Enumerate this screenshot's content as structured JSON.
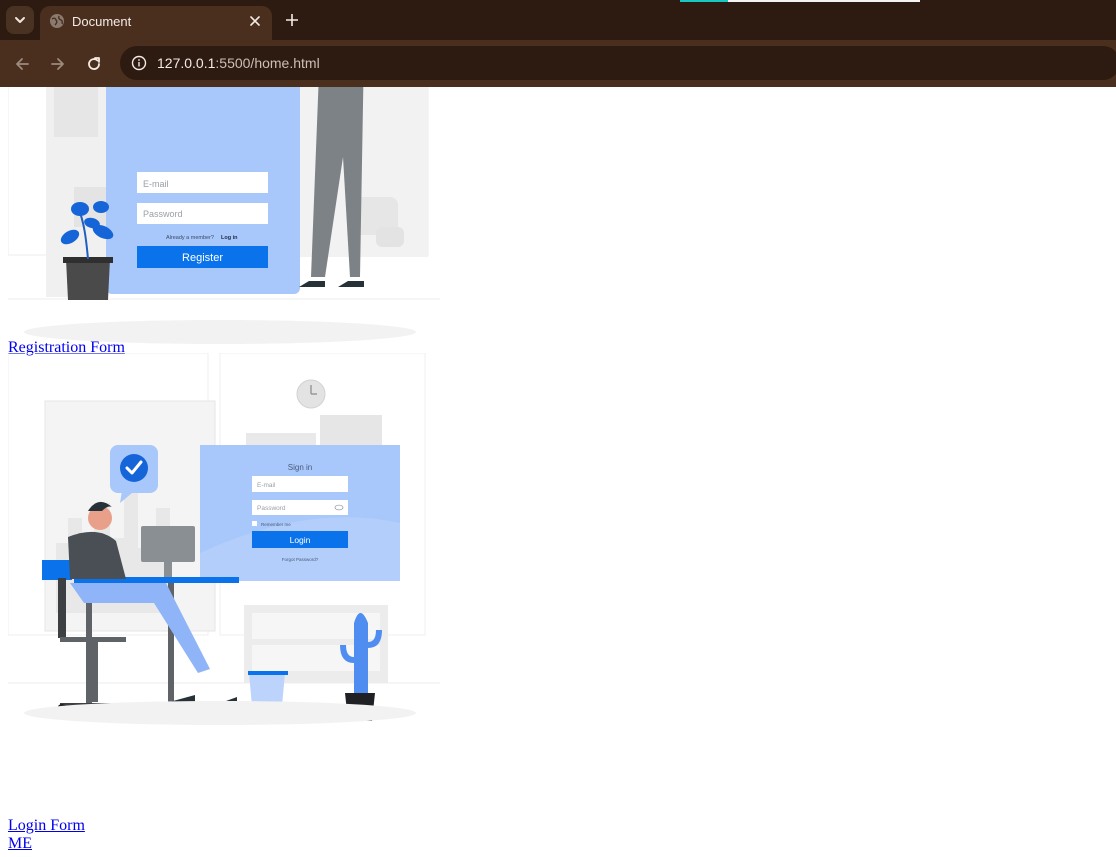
{
  "browser": {
    "tab": {
      "title": "Document"
    },
    "address_bar": {
      "url_host": "127.0.0.1",
      "url_rest": ":5500/home.html"
    }
  },
  "illustrations": {
    "register": {
      "fields": [
        "E-mail",
        "Password"
      ],
      "member_text": "Already a member?",
      "login_link": "Log in",
      "button": "Register"
    },
    "login": {
      "heading": "Sign in",
      "fields": [
        "E-mail",
        "Password"
      ],
      "remember": "Remember me",
      "button": "Login",
      "forgot": "Forgot Password?"
    }
  },
  "links": {
    "registration": "Registration Form",
    "login": "Login Form",
    "me": "ME"
  },
  "colors": {
    "chrome_dark": "#2d1a10",
    "chrome_mid": "#4b2f1e",
    "accent_blue": "#1a73e8",
    "link": "#0000ee"
  }
}
